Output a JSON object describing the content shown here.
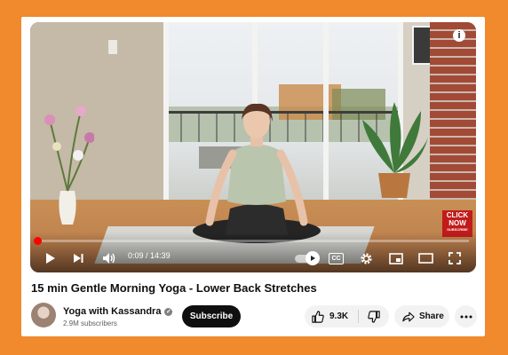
{
  "video": {
    "time_current": "0:09",
    "time_total": "14:39",
    "progress": 0.01,
    "overlay_badge_lines": [
      "CLICK",
      "NOW"
    ],
    "overlay_badge_sub": "SUBSCRIBE",
    "cc_label": "CC",
    "accent_color": "#ff0000"
  },
  "meta": {
    "title": "15 min Gentle Morning Yoga - Lower Back Stretches",
    "channel_name": "Yoga with Kassandra",
    "subscribers": "2.9M subscribers",
    "subscribe_label": "Subscribe",
    "like_count": "9.3K",
    "share_label": "Share"
  },
  "icons": [
    "info-icon",
    "play-icon",
    "next-icon",
    "volume-icon",
    "autoplay-toggle",
    "cc-icon",
    "settings-icon",
    "miniplayer-icon",
    "theater-icon",
    "fullscreen-icon",
    "verified-icon",
    "like-icon",
    "dislike-icon",
    "share-icon",
    "more-icon"
  ]
}
